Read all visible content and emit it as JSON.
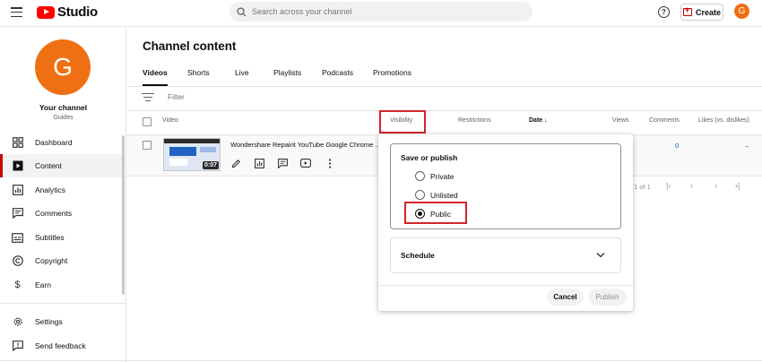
{
  "app": {
    "title": "Studio"
  },
  "search": {
    "placeholder": "Search across your channel"
  },
  "header": {
    "help_label": "?",
    "create_label": "Create",
    "avatar_initial": "G"
  },
  "sidebar": {
    "avatar_initial": "G",
    "channel_name": "Your channel",
    "channel_handle": "Guides",
    "items": [
      {
        "label": "Dashboard",
        "icon": "dashboard-icon"
      },
      {
        "label": "Content",
        "icon": "content-icon",
        "active": true
      },
      {
        "label": "Analytics",
        "icon": "analytics-icon"
      },
      {
        "label": "Comments",
        "icon": "comments-icon"
      },
      {
        "label": "Subtitles",
        "icon": "subtitles-icon"
      },
      {
        "label": "Copyright",
        "icon": "copyright-icon"
      },
      {
        "label": "Earn",
        "icon": "earn-icon"
      }
    ],
    "bottom_items": [
      {
        "label": "Settings",
        "icon": "settings-icon"
      },
      {
        "label": "Send feedback",
        "icon": "feedback-icon"
      }
    ]
  },
  "main": {
    "title": "Channel content",
    "tabs": [
      {
        "label": "Videos",
        "active": true
      },
      {
        "label": "Shorts"
      },
      {
        "label": "Live"
      },
      {
        "label": "Playlists"
      },
      {
        "label": "Podcasts"
      },
      {
        "label": "Promotions"
      }
    ],
    "filter_placeholder": "Filter",
    "columns": {
      "video": "Video",
      "visibility": "Visibility",
      "restrictions": "Restrictions",
      "date": "Date ↓",
      "views": "Views",
      "comments": "Comments",
      "likes": "Likes (vs. dislikes)"
    },
    "rows": [
      {
        "title": "Wondershare Repairit YouTube Google Chrome ...",
        "duration": "0:07",
        "comments": "0",
        "likes": "–"
      }
    ],
    "pagination": {
      "text": "1 of 1"
    }
  },
  "popup": {
    "title": "Save or publish",
    "options": [
      {
        "label": "Private",
        "selected": false
      },
      {
        "label": "Unlisted",
        "selected": false
      },
      {
        "label": "Public",
        "selected": true
      }
    ],
    "schedule_label": "Schedule",
    "cancel_label": "Cancel",
    "publish_label": "Publish"
  },
  "colors": {
    "brand_red": "#ff0000",
    "avatar_orange": "#ef7012",
    "highlight_red": "#d3242c",
    "link_blue": "#065fd4"
  }
}
